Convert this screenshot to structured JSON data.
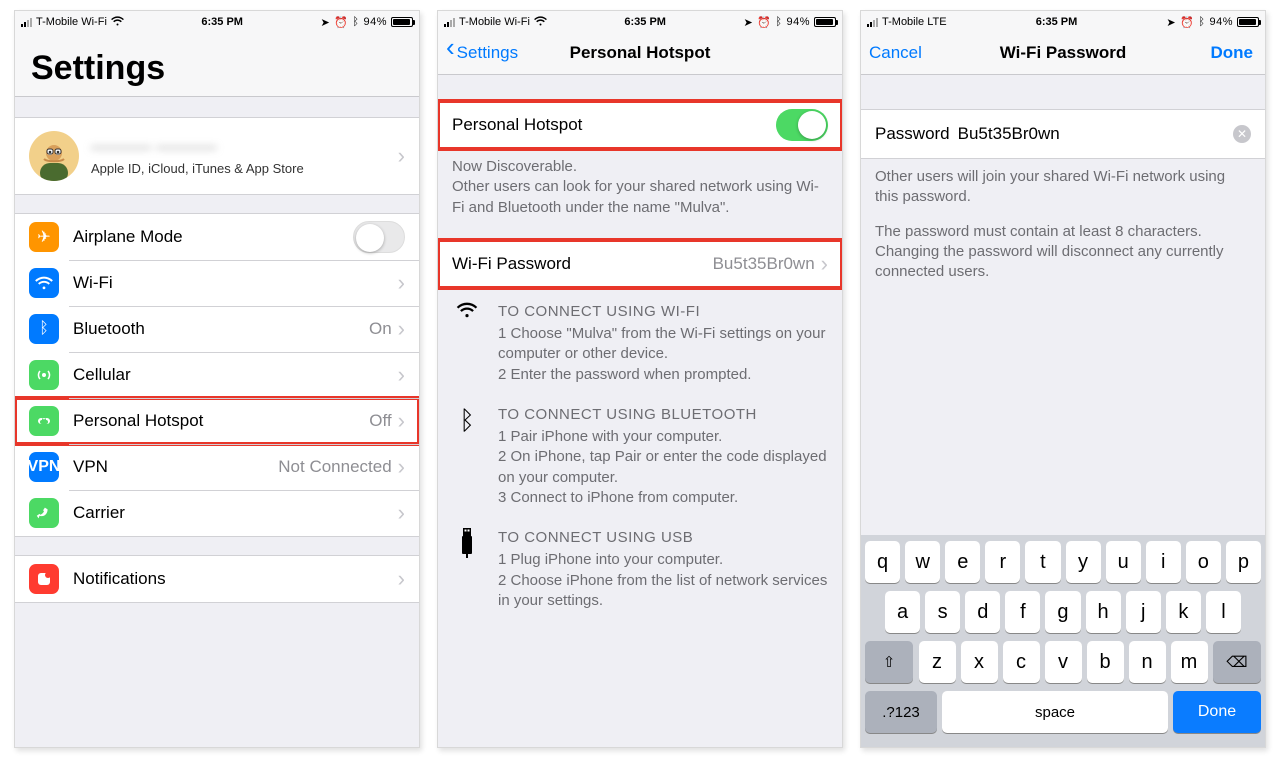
{
  "status": {
    "carrier_wifi": "T-Mobile Wi-Fi",
    "carrier_lte": "T-Mobile  LTE",
    "time": "6:35 PM",
    "battery_pct": "94%"
  },
  "panel1": {
    "title": "Settings",
    "profile": {
      "name": "——— ———",
      "sub": "Apple ID, iCloud, iTunes & App Store"
    },
    "rows": {
      "airplane": "Airplane Mode",
      "wifi": "Wi-Fi",
      "wifi_value": "",
      "bluetooth": "Bluetooth",
      "bluetooth_value": "On",
      "cellular": "Cellular",
      "hotspot": "Personal Hotspot",
      "hotspot_value": "Off",
      "vpn": "VPN",
      "vpn_value": "Not Connected",
      "carrier": "Carrier",
      "carrier_value": ""
    },
    "notifications": "Notifications"
  },
  "panel2": {
    "back": "Settings",
    "title": "Personal Hotspot",
    "toggle_label": "Personal Hotspot",
    "discoverable_hdr": "Now Discoverable.",
    "discoverable_body": "Other users can look for your shared network using Wi-Fi and Bluetooth under the name \"Mulva\".",
    "wifi_pwd_label": "Wi-Fi Password",
    "wifi_pwd_value": "Bu5t35Br0wn",
    "wifi": {
      "hdr": "TO CONNECT USING WI-FI",
      "s1": "1 Choose \"Mulva\" from the Wi-Fi settings on your computer or other device.",
      "s2": "2 Enter the password when prompted."
    },
    "bt": {
      "hdr": "TO CONNECT USING BLUETOOTH",
      "s1": "1 Pair iPhone with your computer.",
      "s2": "2 On iPhone, tap Pair or enter the code displayed on your computer.",
      "s3": "3 Connect to iPhone from computer."
    },
    "usb": {
      "hdr": "TO CONNECT USING USB",
      "s1": "1 Plug iPhone into your computer.",
      "s2": "2 Choose iPhone from the list of network services in your settings."
    }
  },
  "panel3": {
    "cancel": "Cancel",
    "title": "Wi-Fi Password",
    "done": "Done",
    "pwd_label": "Password",
    "pwd_value": "Bu5t35Br0wn",
    "help1": "Other users will join your shared Wi-Fi network using this password.",
    "help2": "The password must contain at least 8 characters. Changing the password will disconnect any currently connected users."
  },
  "keyboard": {
    "row1": [
      "q",
      "w",
      "e",
      "r",
      "t",
      "y",
      "u",
      "i",
      "o",
      "p"
    ],
    "row2": [
      "a",
      "s",
      "d",
      "f",
      "g",
      "h",
      "j",
      "k",
      "l"
    ],
    "row3": [
      "z",
      "x",
      "c",
      "v",
      "b",
      "n",
      "m"
    ],
    "sym": ".?123",
    "space": "space",
    "done": "Done"
  }
}
